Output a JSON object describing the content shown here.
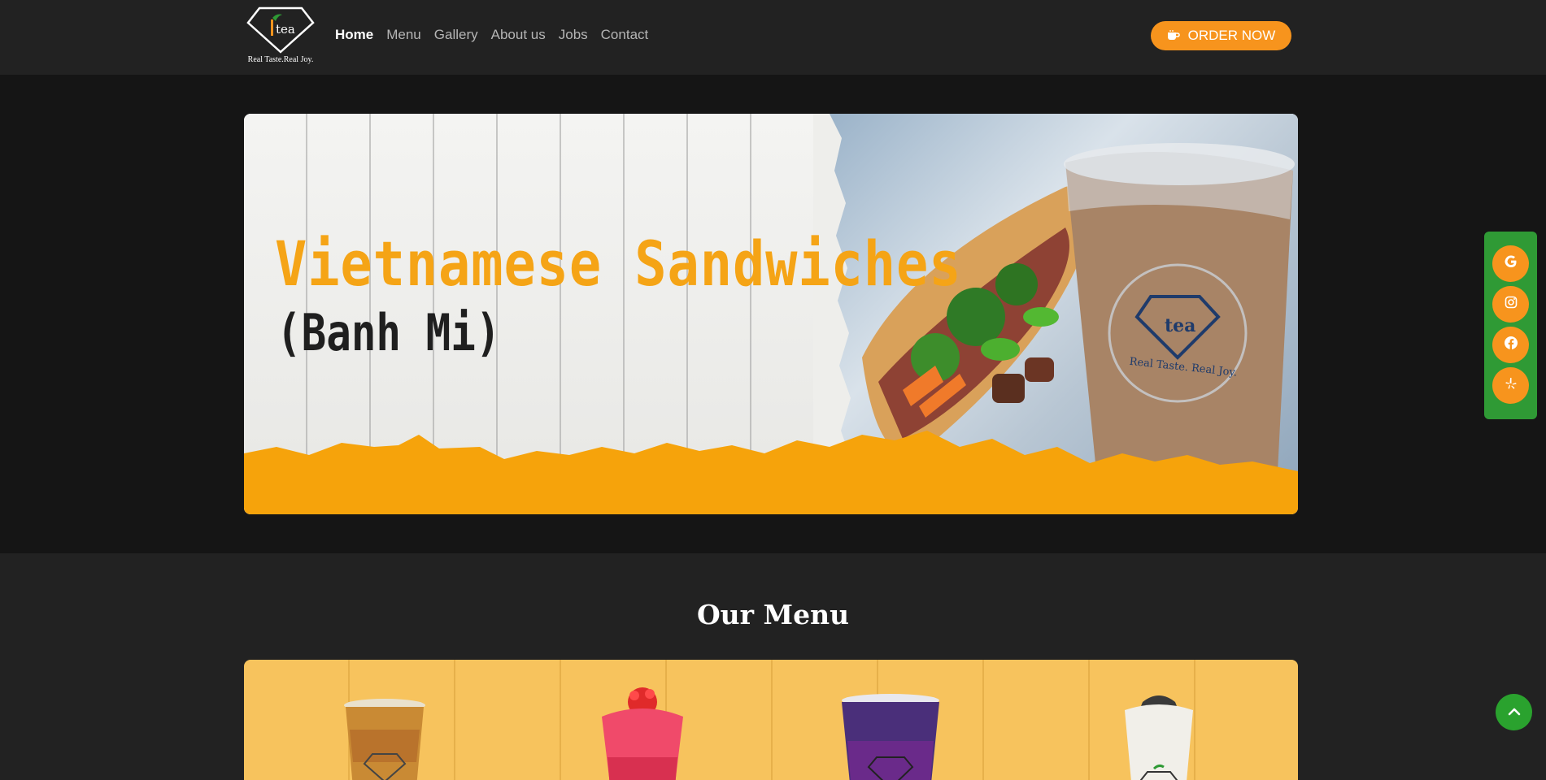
{
  "brand": {
    "name": "tea",
    "tagline": "Real Taste.Real Joy."
  },
  "nav": {
    "items": [
      {
        "label": "Home",
        "active": true
      },
      {
        "label": "Menu",
        "active": false
      },
      {
        "label": "Gallery",
        "active": false
      },
      {
        "label": "About us",
        "active": false
      },
      {
        "label": "Jobs",
        "active": false
      },
      {
        "label": "Contact",
        "active": false
      }
    ],
    "cta_label": "ORDER NOW",
    "cta_icon": "coffee-cup-icon"
  },
  "hero": {
    "title": "Vietnamese Sandwiches",
    "subtitle": "(Banh Mi)",
    "cup_logo": "tea",
    "cup_tagline": "Real Taste. Real Joy."
  },
  "menu": {
    "heading": "Our Menu"
  },
  "social": {
    "items": [
      "google-icon",
      "instagram-icon",
      "facebook-icon",
      "yelp-icon"
    ]
  },
  "colors": {
    "accent": "#f7941d",
    "hero_title": "#f5a416",
    "social_bg": "#2f9a35",
    "header_bg": "#222222",
    "page_bg": "#151515"
  }
}
